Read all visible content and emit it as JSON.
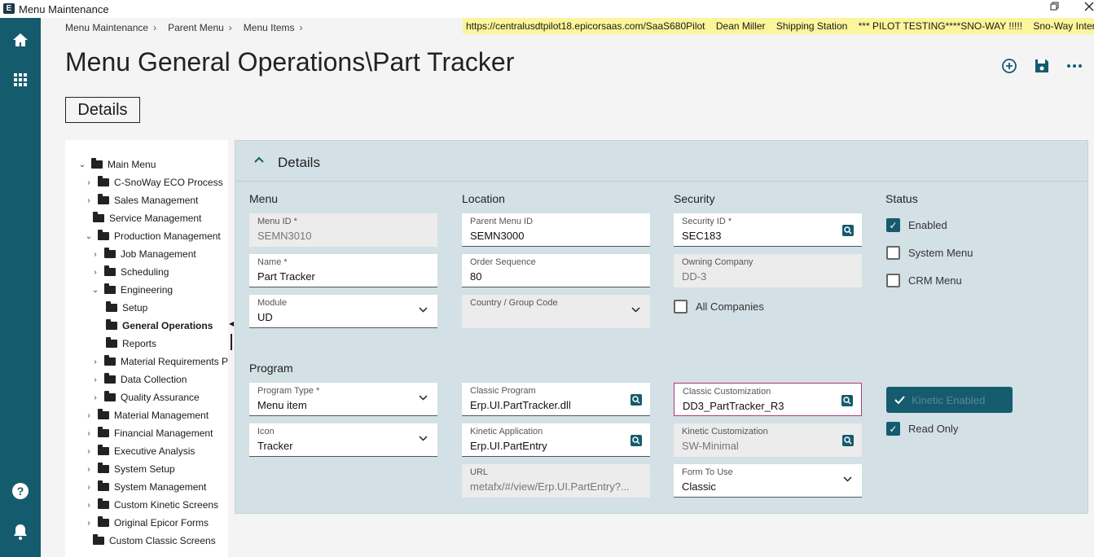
{
  "window": {
    "title": "Menu Maintenance",
    "logo": "E"
  },
  "breadcrumb": [
    "Menu Maintenance",
    "Parent Menu",
    "Menu Items"
  ],
  "infobar": {
    "url": "https://centralusdtpilot18.epicorsaas.com/SaaS680Pilot",
    "user": "Dean Miller",
    "station": "Shipping Station",
    "banner": "*** PILOT TESTING****SNO-WAY !!!!!",
    "company": "Sno-Way International, Inc"
  },
  "page": {
    "title": "Menu General Operations\\Part Tracker",
    "tab": "Details"
  },
  "tree": [
    {
      "label": "Main Menu",
      "expanded": true
    },
    {
      "label": "C-SnoWay ECO Process",
      "expanded": false
    },
    {
      "label": "Sales Management",
      "expanded": false
    },
    {
      "label": "Service Management"
    },
    {
      "label": "Production Management",
      "expanded": true
    },
    {
      "label": "Job Management",
      "expanded": false
    },
    {
      "label": "Scheduling",
      "expanded": false
    },
    {
      "label": "Engineering",
      "expanded": true
    },
    {
      "label": "Setup"
    },
    {
      "label": "General Operations",
      "selected": true
    },
    {
      "label": "Reports"
    },
    {
      "label": "Material Requirements Pla",
      "expanded": false
    },
    {
      "label": "Data Collection",
      "expanded": false
    },
    {
      "label": "Quality Assurance",
      "expanded": false
    },
    {
      "label": "Material Management",
      "expanded": false
    },
    {
      "label": "Financial Management",
      "expanded": false
    },
    {
      "label": "Executive Analysis",
      "expanded": false
    },
    {
      "label": "System Setup",
      "expanded": false
    },
    {
      "label": "System Management",
      "expanded": false
    },
    {
      "label": "Custom Kinetic Screens",
      "expanded": false
    },
    {
      "label": "Original Epicor Forms",
      "expanded": false
    },
    {
      "label": "Custom Classic Screens"
    }
  ],
  "panel": {
    "title": "Details"
  },
  "sections": {
    "menu": "Menu",
    "location": "Location",
    "security": "Security",
    "status": "Status",
    "program": "Program"
  },
  "fields": {
    "menu_id": {
      "label": "Menu ID *",
      "value": "SEMN3010"
    },
    "name": {
      "label": "Name *",
      "value": "Part Tracker"
    },
    "module": {
      "label": "Module",
      "value": "UD"
    },
    "parent_menu_id": {
      "label": "Parent Menu ID",
      "value": "SEMN3000"
    },
    "order_sequence": {
      "label": "Order Sequence",
      "value": "80"
    },
    "country_group": {
      "label": "Country / Group Code",
      "value": ""
    },
    "security_id": {
      "label": "Security ID *",
      "value": "SEC183"
    },
    "owning_company": {
      "label": "Owning Company",
      "value": "DD-3"
    },
    "program_type": {
      "label": "Program Type *",
      "value": "Menu item"
    },
    "icon": {
      "label": "Icon",
      "value": "Tracker"
    },
    "classic_program": {
      "label": "Classic Program",
      "value": "Erp.UI.PartTracker.dll"
    },
    "kinetic_application": {
      "label": "Kinetic Application",
      "value": "Erp.UI.PartEntry"
    },
    "url": {
      "label": "URL",
      "value": "metafx/#/view/Erp.UI.PartEntry?..."
    },
    "classic_customization": {
      "label": "Classic Customization",
      "value": "DD3_PartTracker_R3"
    },
    "kinetic_customization": {
      "label": "Kinetic Customization",
      "value": "SW-Minimal"
    },
    "form_to_use": {
      "label": "Form To Use",
      "value": "Classic"
    }
  },
  "checkboxes": {
    "all_companies": {
      "label": "All Companies",
      "checked": false
    },
    "enabled": {
      "label": "Enabled",
      "checked": true
    },
    "system_menu": {
      "label": "System Menu",
      "checked": false
    },
    "crm_menu": {
      "label": "CRM Menu",
      "checked": false
    },
    "read_only": {
      "label": "Read Only",
      "checked": true
    }
  },
  "kinetic_enabled": {
    "label": "Kinetic Enabled",
    "checked": true
  },
  "colors": {
    "rail": "#155b6e",
    "accent": "#155b6e",
    "panel": "#d3e0e5",
    "infobar": "#fbf59b",
    "highlight_border": "#b4367a"
  },
  "icons": {
    "rail": [
      "home-icon",
      "apps-grid-icon",
      "help-icon",
      "bell-icon"
    ],
    "actions": [
      "add-icon",
      "save-icon",
      "more-icon"
    ]
  }
}
